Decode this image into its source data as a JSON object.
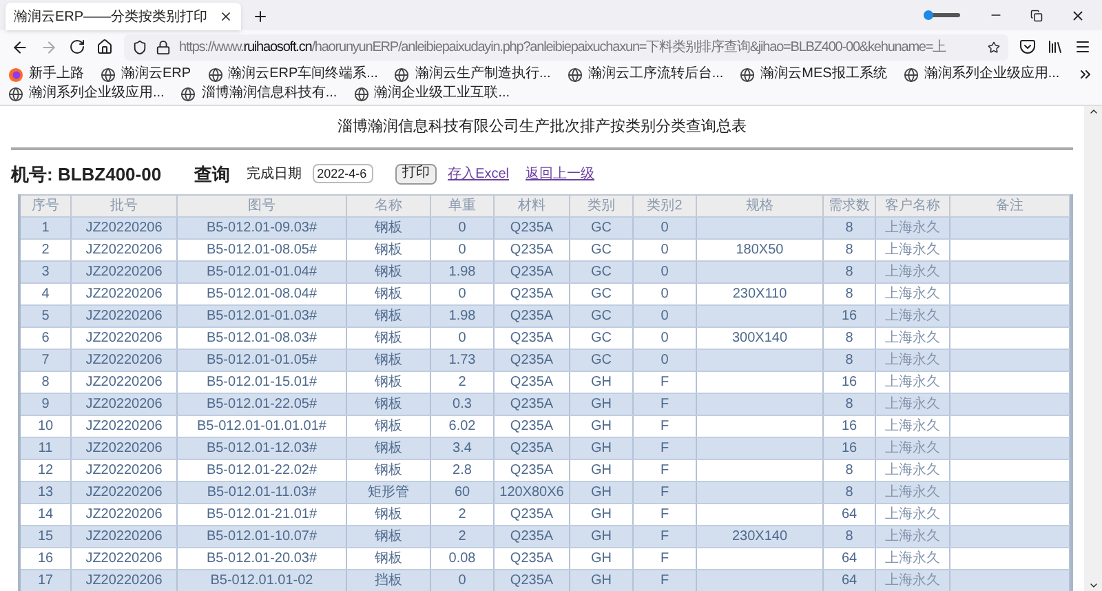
{
  "browser": {
    "tab_title": "瀚润云ERP——分类按类别打印",
    "url": {
      "scheme": "https://www.",
      "host": "ruihaosoft.cn",
      "path": "/haorunyunERP/anleibiepaixudayin.php?anleibiepaixuchaxun=下料类别排序查询&jihao=BLBZ400-00&kehuname=上"
    },
    "bookmarks": [
      {
        "label": "新手上路",
        "kind": "start"
      },
      {
        "label": "瀚润云ERP",
        "kind": "globe"
      },
      {
        "label": "瀚润云ERP车间终端系...",
        "kind": "globe"
      },
      {
        "label": "瀚润云生产制造执行...",
        "kind": "globe"
      },
      {
        "label": "瀚润云工序流转后台...",
        "kind": "globe"
      },
      {
        "label": "瀚润云MES报工系统",
        "kind": "globe"
      },
      {
        "label": "瀚润系列企业级应用...",
        "kind": "globe"
      },
      {
        "label": "瀚润系列企业级应用...",
        "kind": "globe"
      },
      {
        "label": "淄博瀚润信息科技有...",
        "kind": "globe"
      },
      {
        "label": "瀚润企业级工业互联...",
        "kind": "globe"
      }
    ]
  },
  "page": {
    "title": "淄博瀚润信息科技有限公司生产批次排产按类别分类查询总表",
    "machine": "机号: BLBZ400-00",
    "query": "查询",
    "date_label": "完成日期",
    "date_value": "2022-4-6",
    "print_button": "打印",
    "links": [
      "存入Excel",
      "返回上一级"
    ]
  },
  "table": {
    "columns": [
      "序号",
      "批号",
      "图号",
      "名称",
      "单重",
      "材料",
      "类别",
      "类别2",
      "规格",
      "需求数",
      "客户名称",
      "备注"
    ],
    "rows": [
      {
        "no": "1",
        "batch": "JZ20220206",
        "drawing": "B5-012.01-09.03#",
        "name": "钢板",
        "weight": "0",
        "material": "Q235A",
        "category": "GC",
        "category2": "0",
        "qty": "8",
        "customer": "上海永久"
      },
      {
        "no": "2",
        "batch": "JZ20220206",
        "drawing": "B5-012.01-08.05#",
        "name": "钢板",
        "weight": "0",
        "material": "Q235A",
        "category": "GC",
        "category2": "0",
        "spec": "180X50",
        "qty": "8",
        "customer": "上海永久"
      },
      {
        "no": "3",
        "batch": "JZ20220206",
        "drawing": "B5-012.01-01.04#",
        "name": "钢板",
        "weight": "1.98",
        "material": "Q235A",
        "category": "GC",
        "category2": "0",
        "qty": "8",
        "customer": "上海永久"
      },
      {
        "no": "4",
        "batch": "JZ20220206",
        "drawing": "B5-012.01-08.04#",
        "name": "钢板",
        "weight": "0",
        "material": "Q235A",
        "category": "GC",
        "category2": "0",
        "spec": "230X110",
        "qty": "8",
        "customer": "上海永久"
      },
      {
        "no": "5",
        "batch": "JZ20220206",
        "drawing": "B5-012.01-01.03#",
        "name": "钢板",
        "weight": "1.98",
        "material": "Q235A",
        "category": "GC",
        "category2": "0",
        "qty": "16",
        "customer": "上海永久"
      },
      {
        "no": "6",
        "batch": "JZ20220206",
        "drawing": "B5-012.01-08.03#",
        "name": "钢板",
        "weight": "0",
        "material": "Q235A",
        "category": "GC",
        "category2": "0",
        "spec": "300X140",
        "qty": "8",
        "customer": "上海永久"
      },
      {
        "no": "7",
        "batch": "JZ20220206",
        "drawing": "B5-012.01-01.05#",
        "name": "钢板",
        "weight": "1.73",
        "material": "Q235A",
        "category": "GC",
        "category2": "0",
        "qty": "8",
        "customer": "上海永久"
      },
      {
        "no": "8",
        "batch": "JZ20220206",
        "drawing": "B5-012.01-15.01#",
        "name": "钢板",
        "weight": "2",
        "material": "Q235A",
        "category": "GH",
        "category2": "F",
        "qty": "16",
        "customer": "上海永久"
      },
      {
        "no": "9",
        "batch": "JZ20220206",
        "drawing": "B5-012.01-22.05#",
        "name": "钢板",
        "weight": "0.3",
        "material": "Q235A",
        "category": "GH",
        "category2": "F",
        "qty": "8",
        "customer": "上海永久"
      },
      {
        "no": "10",
        "batch": "JZ20220206",
        "drawing": "B5-012.01-01.01.01#",
        "name": "钢板",
        "weight": "6.02",
        "material": "Q235A",
        "category": "GH",
        "category2": "F",
        "qty": "16",
        "customer": "上海永久"
      },
      {
        "no": "11",
        "batch": "JZ20220206",
        "drawing": "B5-012.01-12.03#",
        "name": "钢板",
        "weight": "3.4",
        "material": "Q235A",
        "category": "GH",
        "category2": "F",
        "qty": "16",
        "customer": "上海永久"
      },
      {
        "no": "12",
        "batch": "JZ20220206",
        "drawing": "B5-012.01-22.02#",
        "name": "钢板",
        "weight": "2.8",
        "material": "Q235A",
        "category": "GH",
        "category2": "F",
        "qty": "8",
        "customer": "上海永久"
      },
      {
        "no": "13",
        "batch": "JZ20220206",
        "drawing": "B5-012.01-11.03#",
        "name": "矩形管",
        "weight": "60",
        "material": "120X80X6",
        "category": "GH",
        "category2": "F",
        "qty": "8",
        "customer": "上海永久"
      },
      {
        "no": "14",
        "batch": "JZ20220206",
        "drawing": "B5-012.01-21.01#",
        "name": "钢板",
        "weight": "2",
        "material": "Q235A",
        "category": "GH",
        "category2": "F",
        "qty": "64",
        "customer": "上海永久"
      },
      {
        "no": "15",
        "batch": "JZ20220206",
        "drawing": "B5-012.01-10.07#",
        "name": "钢板",
        "weight": "2",
        "material": "Q235A",
        "category": "GH",
        "category2": "F",
        "spec": "230X140",
        "qty": "8",
        "customer": "上海永久"
      },
      {
        "no": "16",
        "batch": "JZ20220206",
        "drawing": "B5-012.01-20.03#",
        "name": "钢板",
        "weight": "0.08",
        "material": "Q235A",
        "category": "GH",
        "category2": "F",
        "qty": "64",
        "customer": "上海永久"
      },
      {
        "no": "17",
        "batch": "JZ20220206",
        "drawing": "B5-012.01.01-02",
        "name": "挡板",
        "weight": "0",
        "material": "Q235A",
        "category": "GH",
        "category2": "F",
        "qty": "64",
        "customer": "上海永久"
      }
    ]
  }
}
